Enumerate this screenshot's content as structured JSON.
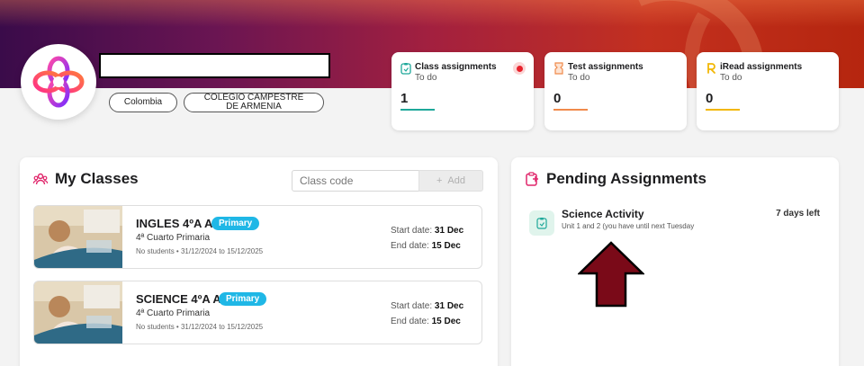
{
  "profile": {
    "name": "",
    "country": "Colombia",
    "school": "COLEGIO CAMPESTRE DE ARMENIA"
  },
  "stats": [
    {
      "title": "Class assignments",
      "subtitle": "To do",
      "count": "1",
      "color": "#1ea89a",
      "notification": true
    },
    {
      "title": "Test assignments",
      "subtitle": "To do",
      "count": "0",
      "color": "#f08a4b",
      "notification": false
    },
    {
      "title": "iRead assignments",
      "subtitle": "To do",
      "count": "0",
      "color": "#f2b705",
      "notification": false
    }
  ],
  "my_classes": {
    "title": "My Classes",
    "code_placeholder": "Class code",
    "add_label": "Add",
    "accent": "#e0266b",
    "classes": [
      {
        "name": "INGLES 4ºA A",
        "badge": "Primary",
        "grade": "4ª Cuarto Primaria",
        "meta": "No students • 31/12/2024 to 15/12/2025",
        "start_label": "Start date:",
        "start": "31 Dec",
        "end_label": "End date:",
        "end": "15 Dec"
      },
      {
        "name": "SCIENCE 4ºA A",
        "badge": "Primary",
        "grade": "4ª Cuarto Primaria",
        "meta": "No students • 31/12/2024 to 15/12/2025",
        "start_label": "Start date:",
        "start": "31 Dec",
        "end_label": "End date:",
        "end": "15 Dec"
      }
    ]
  },
  "pending": {
    "title": "Pending Assignments",
    "accent": "#e0266b",
    "items": [
      {
        "title": "Science Activity",
        "description": "Unit 1 and 2 (you have until next Tuesday",
        "due": "7 days left"
      }
    ]
  },
  "annotation": {
    "arrow_color": "#7a0a18"
  }
}
